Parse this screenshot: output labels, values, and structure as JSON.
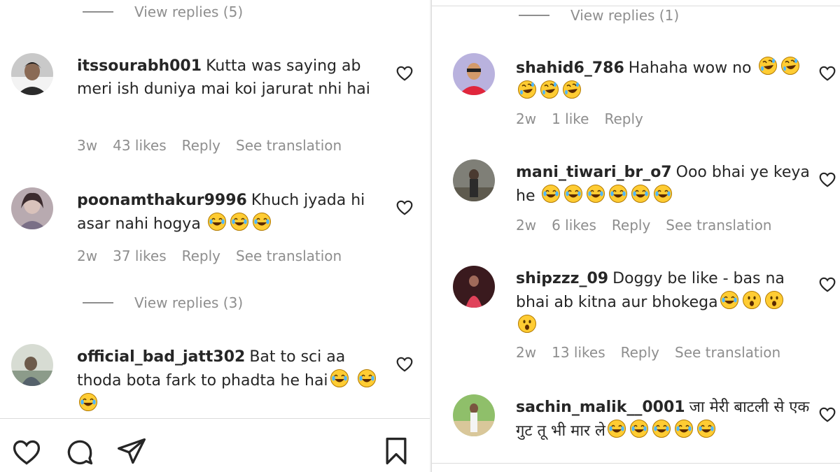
{
  "left": {
    "top_view_replies": "View replies (5)",
    "comments": [
      {
        "username": "itssourabh001",
        "text": "Kutta was saying ab meri ish duniya mai koi jarurat nhi hai",
        "time": "3w",
        "likes": "43 likes",
        "reply": "Reply",
        "translate": "See translation"
      },
      {
        "username": "poonamthakur9996",
        "text": "Khuch jyada hi asar nahi hogya",
        "time": "2w",
        "likes": "37 likes",
        "reply": "Reply",
        "translate": "See translation"
      },
      {
        "username": "official_bad_jatt302",
        "text": "Bat to sci aa thoda bota fark to phadta he hai"
      }
    ],
    "mid_view_replies": "View replies (3)"
  },
  "right": {
    "top_view_replies": "View replies (1)",
    "comments": [
      {
        "username": "shahid6_786",
        "text": "Hahaha wow no",
        "time": "2w",
        "likes": "1 like",
        "reply": "Reply"
      },
      {
        "username": "mani_tiwari_br_o7",
        "text": "Ooo bhai ye keya he",
        "time": "2w",
        "likes": "6 likes",
        "reply": "Reply",
        "translate": "See translation"
      },
      {
        "username": "shipzzz_09",
        "text": "Doggy be like - bas na bhai ab kitna aur bhokega",
        "time": "2w",
        "likes": "13 likes",
        "reply": "Reply",
        "translate": "See translation"
      },
      {
        "username": "sachin_malik__0001",
        "text": "जा मेरी बाटली से एक गुट तू भी मार ले"
      }
    ]
  },
  "icons": {
    "like": "heart-icon",
    "comment": "comment-bubble-icon",
    "share": "paper-plane-icon",
    "save": "bookmark-icon",
    "emoji_laugh": "face-with-tears-of-joy-emoji",
    "emoji_rofl": "rolling-on-floor-laughing-emoji",
    "emoji_astonished": "hushed-face-emoji"
  },
  "colors": {
    "text_primary": "#262626",
    "text_secondary": "#8e8e8e",
    "divider": "#dbdbdb",
    "emoji_yellow": "#ffcc33"
  }
}
